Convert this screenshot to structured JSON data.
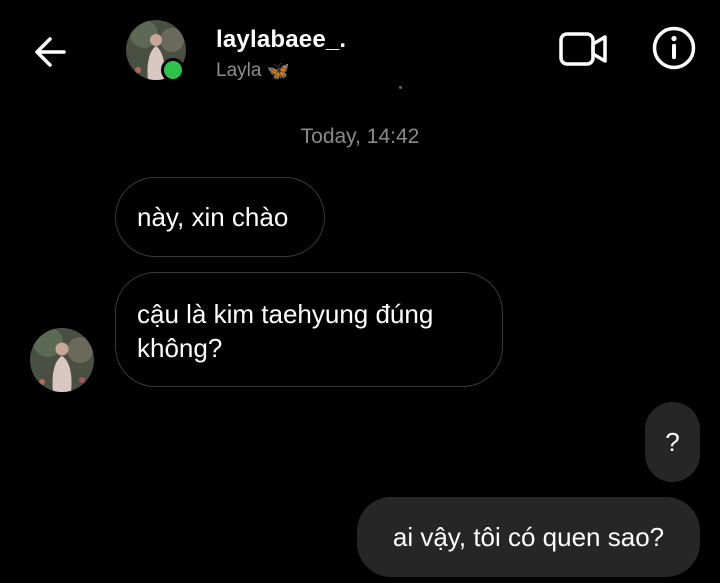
{
  "header": {
    "username": "laylabaee_.",
    "display_name": "Layla",
    "emoji": "🦋",
    "online_status_color": "#2ec14b",
    "icons": {
      "back": "back-arrow-icon",
      "video": "video-call-icon",
      "info": "info-icon"
    }
  },
  "conversation": {
    "timestamp": "Today, 14:42",
    "messages": [
      {
        "direction": "incoming",
        "text": "này, xin chào"
      },
      {
        "direction": "incoming",
        "line1": "cậu là kim taehyung đúng",
        "line2": "không?"
      },
      {
        "direction": "outgoing",
        "text": "?"
      },
      {
        "direction": "outgoing",
        "text": "ai vậy, tôi có quen sao?"
      }
    ]
  },
  "colors": {
    "background": "#000000",
    "incoming_border": "#3a3a3a",
    "outgoing_bubble": "#262626",
    "muted_text": "#8e8e8e"
  }
}
